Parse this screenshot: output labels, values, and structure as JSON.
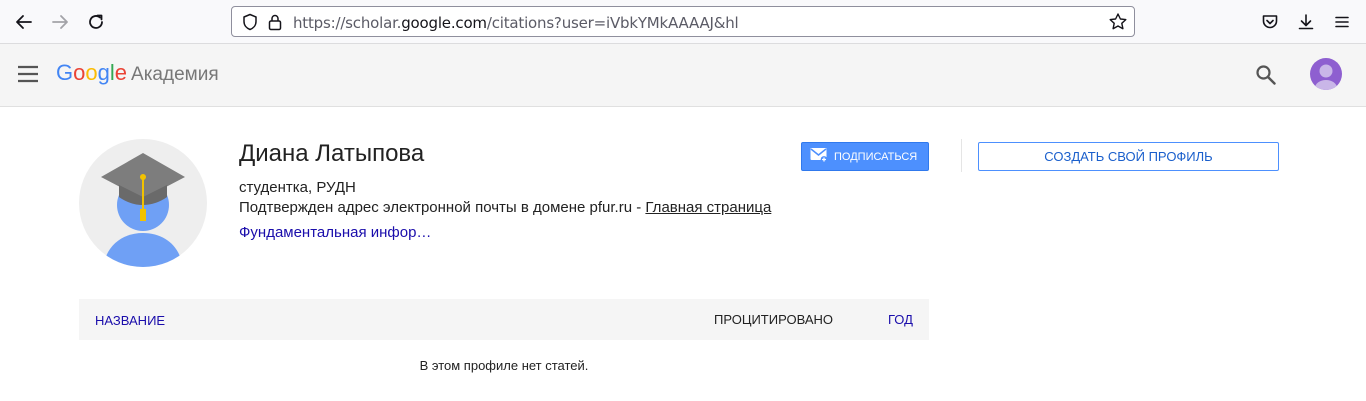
{
  "browser": {
    "url_prefix": "https://scholar.",
    "url_host": "google.com",
    "url_path": "/citations?user=iVbkYMkAAAAJ&hl"
  },
  "header": {
    "logo_letters": [
      "G",
      "o",
      "o",
      "g",
      "l",
      "e"
    ],
    "product": "Академия"
  },
  "profile": {
    "name": "Диана Латыпова",
    "affiliation": "студентка, РУДН",
    "email_text": "Подтвержден адрес электронной почты в домене pfur.ru - ",
    "homepage_label": "Главная страница",
    "interests": "Фундаментальная инфор…"
  },
  "actions": {
    "follow_label": "ПОДПИСАТЬСЯ",
    "create_profile_label": "СОЗДАТЬ СВОЙ ПРОФИЛЬ"
  },
  "articles": {
    "col_title": "НАЗВАНИЕ",
    "col_cited": "ПРОЦИТИРОВАНО",
    "col_year": "ГОД",
    "empty_message": "В этом профиле нет статей."
  },
  "colors": {
    "accent": "#4d90fe",
    "link": "#1a0dab"
  }
}
